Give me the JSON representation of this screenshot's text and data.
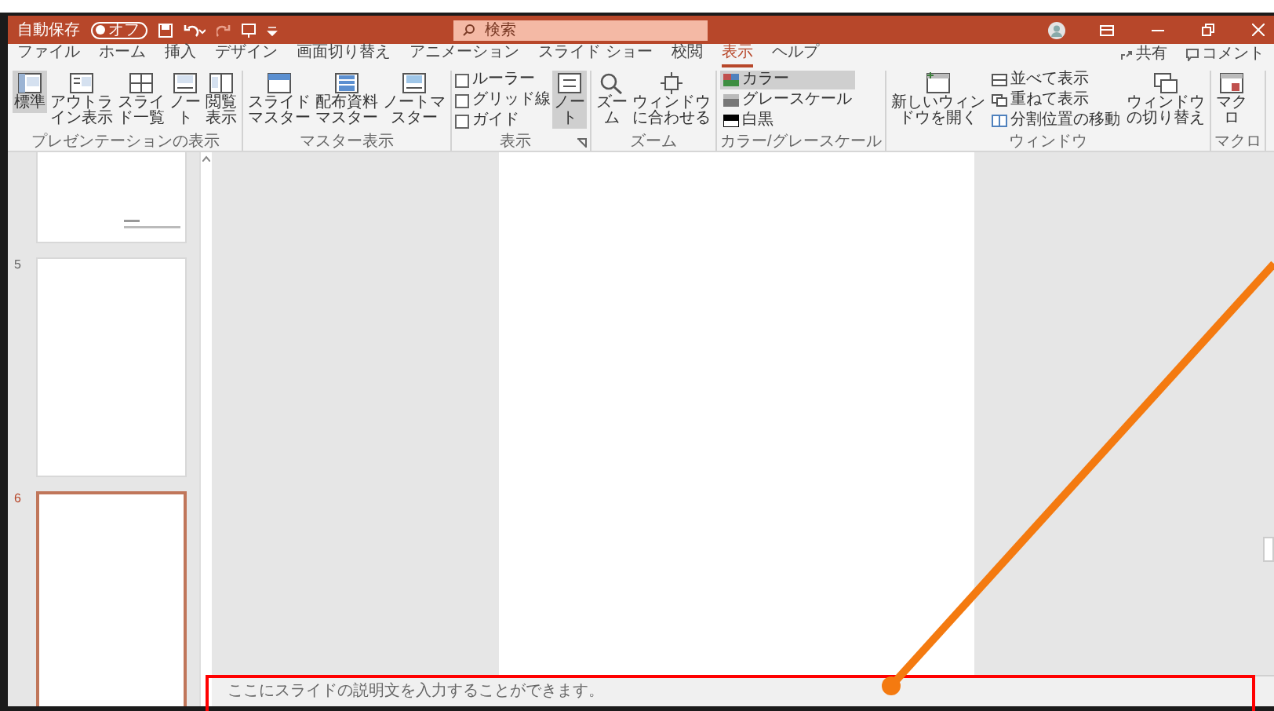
{
  "title_bar": {
    "autosave": {
      "label": "自動保存",
      "value": "オフ",
      "on": false
    },
    "search": {
      "placeholder": "検索"
    }
  },
  "menu_tabs": [
    {
      "label": "ファイル",
      "selected": false
    },
    {
      "label": "ホーム",
      "selected": false
    },
    {
      "label": "挿入",
      "selected": false
    },
    {
      "label": "デザイン",
      "selected": false
    },
    {
      "label": "画面切り替え",
      "selected": false
    },
    {
      "label": "アニメーション",
      "selected": false
    },
    {
      "label": "スライド ショー",
      "selected": false
    },
    {
      "label": "校閲",
      "selected": false
    },
    {
      "label": "表示",
      "selected": true
    },
    {
      "label": "ヘルプ",
      "selected": false
    }
  ],
  "share": {
    "label": "共有"
  },
  "comments": {
    "label": "コメント"
  },
  "ribbon_groups": [
    {
      "label": "プレゼンテーションの表示",
      "items": [
        {
          "kind": "button",
          "label": "標準",
          "selected": true
        },
        {
          "kind": "button",
          "label": "アウトライン表示",
          "selected": false
        },
        {
          "kind": "button",
          "label": "スライド一覧",
          "selected": false
        },
        {
          "kind": "button",
          "label": "ノート",
          "selected": false
        },
        {
          "kind": "button",
          "label": "閲覧表示",
          "selected": false
        }
      ]
    },
    {
      "label": "マスター表示",
      "items": [
        {
          "kind": "button",
          "label": "スライドマスター",
          "selected": false
        },
        {
          "kind": "button",
          "label": "配布資料マスター",
          "selected": false
        },
        {
          "kind": "button",
          "label": "ノートマスター",
          "selected": false
        }
      ]
    },
    {
      "label": "表示",
      "items": [
        {
          "kind": "checkbox",
          "label": "ルーラー",
          "checked": false
        },
        {
          "kind": "checkbox",
          "label": "グリッド線",
          "checked": false
        },
        {
          "kind": "checkbox",
          "label": "ガイド",
          "checked": false
        },
        {
          "kind": "button",
          "label": "ノート",
          "selected": true
        }
      ]
    },
    {
      "label": "ズーム",
      "items": [
        {
          "kind": "button",
          "label": "ズーム",
          "selected": false
        },
        {
          "kind": "button",
          "label": "ウィンドウに合わせる",
          "selected": false
        }
      ]
    },
    {
      "label": "カラー/グレースケール",
      "items": [
        {
          "kind": "small",
          "label": "カラー",
          "selected": true
        },
        {
          "kind": "small",
          "label": "グレースケール",
          "selected": false
        },
        {
          "kind": "small",
          "label": "白黒",
          "selected": false
        }
      ]
    },
    {
      "label": "ウィンドウ",
      "items": [
        {
          "kind": "button",
          "label": "新しいウィンドウを開く",
          "selected": false
        },
        {
          "kind": "small",
          "label": "並べて表示",
          "selected": false
        },
        {
          "kind": "small",
          "label": "重ねて表示",
          "selected": false
        },
        {
          "kind": "small",
          "label": "分割位置の移動",
          "selected": false
        },
        {
          "kind": "button",
          "label": "ウィンドウの切り替え",
          "selected": false
        }
      ]
    },
    {
      "label": "マクロ",
      "items": [
        {
          "kind": "button",
          "label": "マクロ",
          "selected": false
        }
      ]
    }
  ],
  "slides": [
    {
      "selected": false
    },
    {
      "number": "5",
      "selected": false
    },
    {
      "number": "6",
      "selected": true
    }
  ],
  "notes": {
    "placeholder": "ここにスライドの説明文を入力することができます。"
  }
}
